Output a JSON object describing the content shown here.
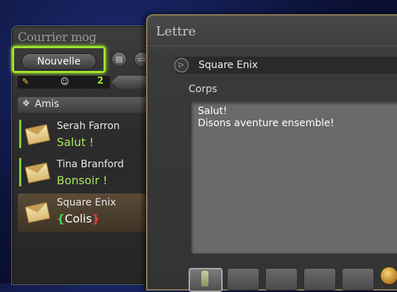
{
  "mail_window": {
    "title": "Courrier mog",
    "new_button_label": "Nouvelle",
    "tab_count": "2",
    "friends_header": "Amis",
    "items": [
      {
        "sender": "Serah Farron",
        "subject": "Salut !"
      },
      {
        "sender": "Tina Branford",
        "subject": "Bonsoir !"
      },
      {
        "sender": "Square Enix",
        "subject_prefix": "{",
        "subject": "Colis",
        "subject_suffix": "}"
      }
    ]
  },
  "letter_window": {
    "title": "Lettre",
    "recipient": "Square Enix",
    "body_label": "Corps",
    "body_text": "Salut!\nDisons aventure ensemble!"
  },
  "colors": {
    "highlight": "#9ee32a",
    "subject_green": "#a6e85a"
  }
}
